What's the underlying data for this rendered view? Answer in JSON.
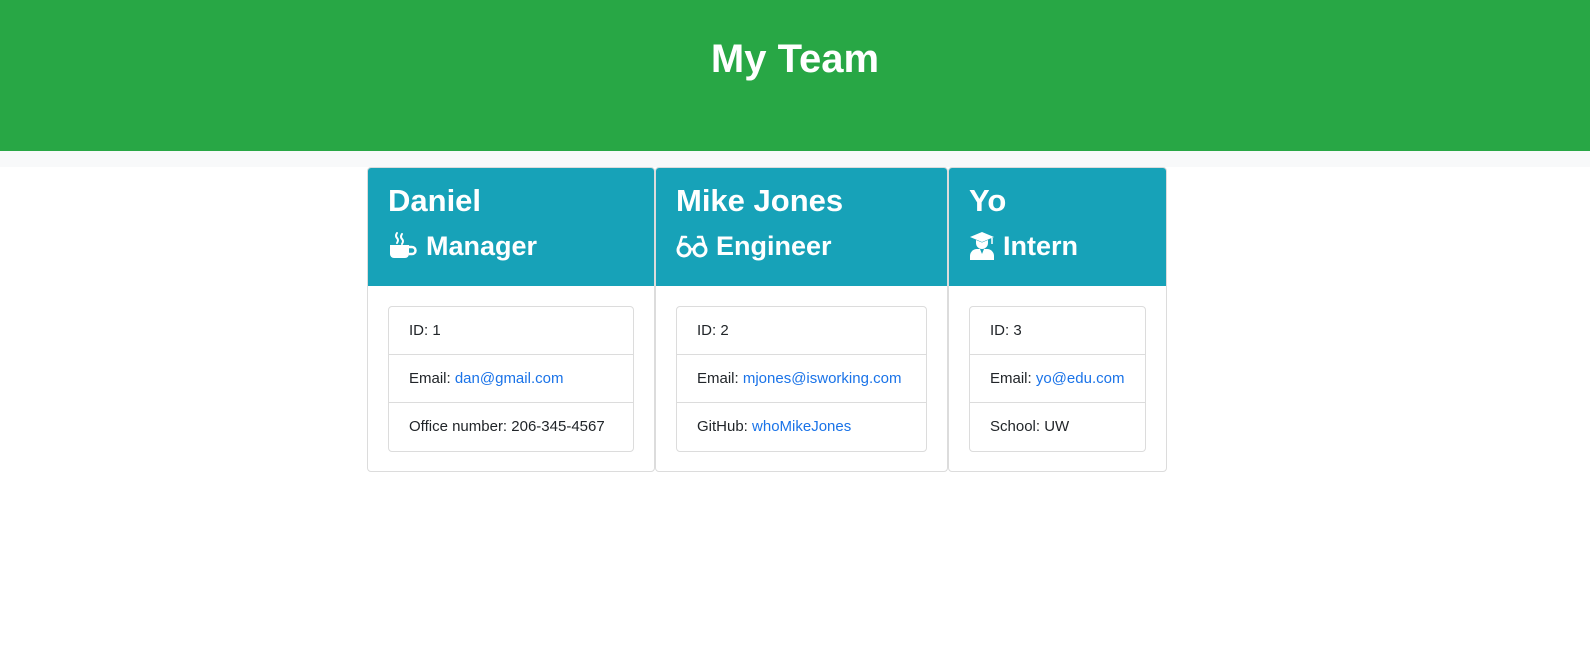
{
  "page": {
    "title": "My Team"
  },
  "colors": {
    "header_bg": "#28a745",
    "card_header_bg": "#17a2b8",
    "link": "#1a73e8"
  },
  "team": [
    {
      "name": "Daniel",
      "role": "Manager",
      "role_icon": "coffee-mug-icon",
      "id_label": "ID: ",
      "id": "1",
      "email_label": "Email: ",
      "email": "dan@gmail.com",
      "extra_label": "Office number: ",
      "extra_value": "206-345-4567"
    },
    {
      "name": "Mike Jones",
      "role": "Engineer",
      "role_icon": "glasses-icon",
      "id_label": "ID: ",
      "id": "2",
      "email_label": "Email: ",
      "email": "mjones@isworking.com",
      "extra_label": "GitHub: ",
      "extra_value": "whoMikeJones"
    },
    {
      "name": "Yo",
      "role": "Intern",
      "role_icon": "graduate-icon",
      "id_label": "ID: ",
      "id": "3",
      "email_label": "Email: ",
      "email": "yo@edu.com",
      "extra_label": "School: ",
      "extra_value": "UW"
    }
  ]
}
